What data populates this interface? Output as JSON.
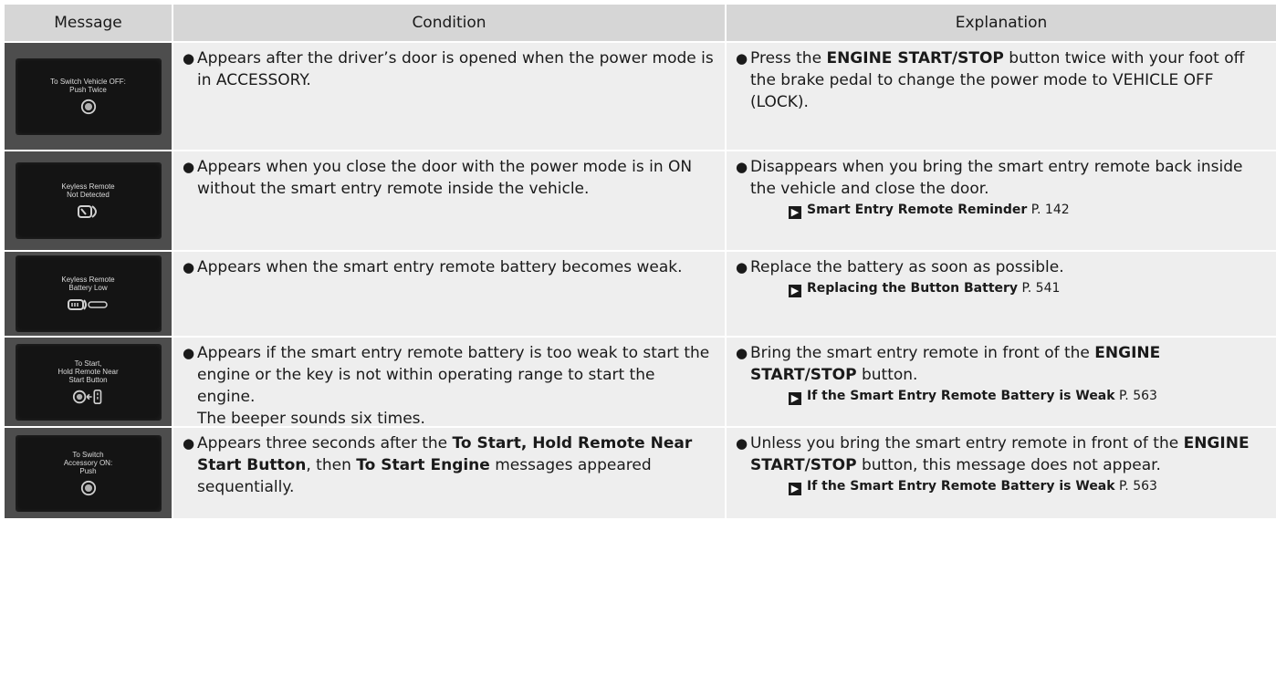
{
  "header": {
    "message": "Message",
    "condition": "Condition",
    "explanation": "Explanation"
  },
  "rows": [
    {
      "screen_text": "To Switch Vehicle OFF:\nPush Twice",
      "screen_icon": "power-button-icon",
      "condition": {
        "pre": "Appears after the driver’s door is opened when the power mode is in ACCESSORY.",
        "b1": "",
        "mid": "",
        "b2": "",
        "post": "",
        "extra": ""
      },
      "explanation": {
        "pre": "Press the ",
        "b1": "ENGINE START/STOP",
        "post": " button twice with your foot off the brake pedal to change the power mode to VEHICLE OFF (LOCK).",
        "ref_title": "",
        "ref_page": ""
      }
    },
    {
      "screen_text": "Keyless Remote\nNot Detected",
      "screen_icon": "remote-missing-icon",
      "condition": {
        "pre": "Appears when you close the door with the power mode is in ON without the smart entry remote inside the vehicle.",
        "b1": "",
        "mid": "",
        "b2": "",
        "post": "",
        "extra": ""
      },
      "explanation": {
        "pre": "Disappears when you bring the smart entry remote back inside the vehicle and close the door.",
        "b1": "",
        "post": "",
        "ref_title": "Smart Entry Remote Reminder",
        "ref_page": "P. 142"
      }
    },
    {
      "screen_text": "Keyless Remote\nBattery Low",
      "screen_icon": "remote-battery-low-icon",
      "condition": {
        "pre": "Appears when the smart entry remote battery becomes weak.",
        "b1": "",
        "mid": "",
        "b2": "",
        "post": "",
        "extra": ""
      },
      "explanation": {
        "pre": "Replace the battery as soon as possible.",
        "b1": "",
        "post": "",
        "ref_title": "Replacing the Button Battery",
        "ref_page": "P. 541"
      }
    },
    {
      "screen_text": "To Start,\nHold Remote Near\nStart Button",
      "screen_icon": "remote-to-button-icon",
      "condition": {
        "pre": "Appears if the smart entry remote battery is too weak to start the engine or the key is not within operating range to start the engine.",
        "b1": "",
        "mid": "",
        "b2": "",
        "post": "",
        "extra": "The beeper sounds six times."
      },
      "explanation": {
        "pre": "Bring the smart entry remote in front of the ",
        "b1": "ENGINE START/STOP",
        "post": " button.",
        "ref_title": "If the Smart Entry Remote Battery is Weak",
        "ref_page": "P. 563"
      }
    },
    {
      "screen_text": "To Switch\nAccessory ON:\nPush",
      "screen_icon": "power-button-icon",
      "condition": {
        "pre": "Appears three seconds after the ",
        "b1": "To Start, Hold Remote Near Start Button",
        "mid": ", then ",
        "b2": "To Start Engine",
        "post": " messages appeared sequentially.",
        "extra": ""
      },
      "explanation": {
        "pre": "Unless you bring the smart entry remote in front of the ",
        "b1": "ENGINE START/STOP",
        "post": " button, this message does not appear.",
        "ref_title": "If the Smart Entry Remote Battery is Weak",
        "ref_page": "P. 563"
      }
    }
  ]
}
